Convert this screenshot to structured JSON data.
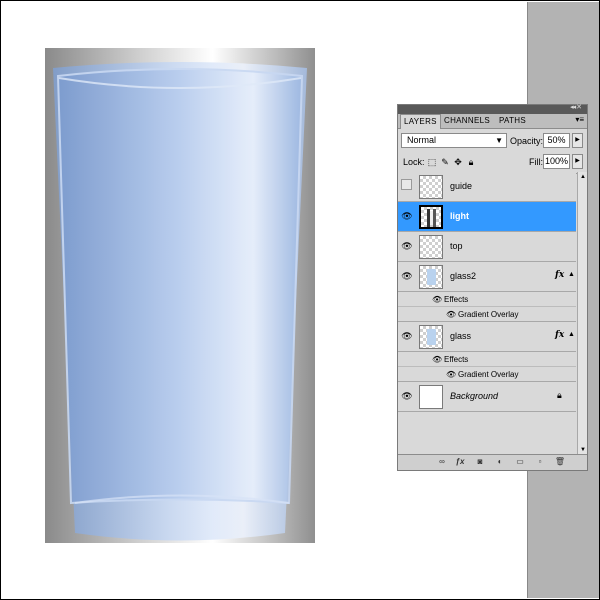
{
  "panel": {
    "tabs": [
      {
        "label": "LAYERS",
        "active": true
      },
      {
        "label": "CHANNELS",
        "active": false
      },
      {
        "label": "PATHS",
        "active": false
      }
    ],
    "blend_mode": "Normal",
    "opacity_label": "Opacity:",
    "opacity_value": "50%",
    "lock_label": "Lock:",
    "fill_label": "Fill:",
    "fill_value": "100%",
    "layers": [
      {
        "name": "guide",
        "visible": false,
        "selected": false
      },
      {
        "name": "light",
        "visible": true,
        "selected": true
      },
      {
        "name": "top",
        "visible": true,
        "selected": false
      },
      {
        "name": "glass2",
        "visible": true,
        "selected": false,
        "fx": "fx",
        "effects_label": "Effects",
        "effect": "Gradient Overlay"
      },
      {
        "name": "glass",
        "visible": true,
        "selected": false,
        "fx": "fx",
        "effects_label": "Effects",
        "effect": "Gradient Overlay"
      },
      {
        "name": "Background",
        "visible": true,
        "selected": false,
        "locked": true
      }
    ]
  },
  "icons": [
    "eye-icon",
    "lock-transparent-icon",
    "brush-icon",
    "move-icon",
    "lock-all-icon",
    "link-icon",
    "fx-icon",
    "mask-icon",
    "adjustment-icon",
    "folder-icon",
    "new-layer-icon",
    "trash-icon",
    "dropdown-arrow-icon",
    "panel-menu-icon",
    "collapse-icon"
  ],
  "colors": {
    "selection": "#3399ff",
    "panel_bg": "#d9d9d9",
    "glass_blue": "#a8c6ec",
    "side_strip": "#b3b3b3"
  }
}
